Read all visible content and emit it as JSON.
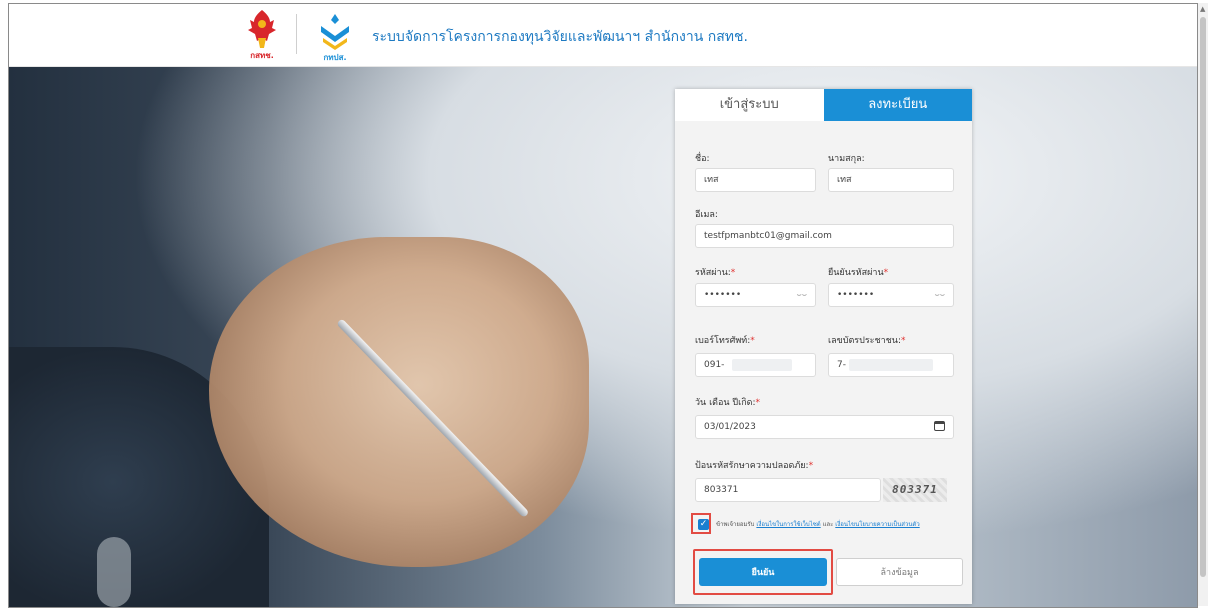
{
  "header": {
    "logo_left_label": "กสทช.",
    "logo_right_label": "กทปส.",
    "title": "ระบบจัดการโครงการกองทุนวิจัยและพัฒนาฯ สำนักงาน กสทช."
  },
  "tabs": {
    "login": "เข้าสู่ระบบ",
    "register": "ลงทะเบียน"
  },
  "form": {
    "first_name": {
      "label": "ชื่อ:",
      "value": "เทส"
    },
    "last_name": {
      "label": "นามสกุล:",
      "value": "เทส"
    },
    "email": {
      "label": "อีเมล:",
      "value": "testfpmanbtc01@gmail.com"
    },
    "password": {
      "label": "รหัสผ่าน:",
      "value": "•••••••"
    },
    "confirm_password": {
      "label": "ยืนยันรหัสผ่าน",
      "value": "•••••••"
    },
    "phone": {
      "label": "เบอร์โทรศัพท์:",
      "value": "091-"
    },
    "id_card": {
      "label": "เลขบัตรประชาชน:",
      "value": "7-"
    },
    "birthdate": {
      "label": "วัน เดือน ปีเกิด:",
      "value": "03/01/2023"
    },
    "captcha": {
      "label": "ป้อนรหัสรักษาความปลอดภัย:",
      "value": "803371",
      "image_text": "803371"
    },
    "required_mark": "*",
    "consent": {
      "prefix": "ข้าพเจ้ายอมรับ",
      "link1": "เงื่อนไขในการใช้เว็บไซต์",
      "connector": "และ",
      "link2": "เงื่อนไขนโยบายความเป็นส่วนตัว",
      "checked": true
    },
    "confirm_button": "ยืนยัน",
    "clear_button": "ล้างข้อมูล"
  },
  "icons": {
    "eye": "eye-closed-icon",
    "calendar": "calendar-icon",
    "check": "check-icon"
  },
  "colors": {
    "primary": "#1a8fd6",
    "title_text": "#1e7ac2",
    "required": "#e0312f",
    "highlight": "#e24b43"
  }
}
